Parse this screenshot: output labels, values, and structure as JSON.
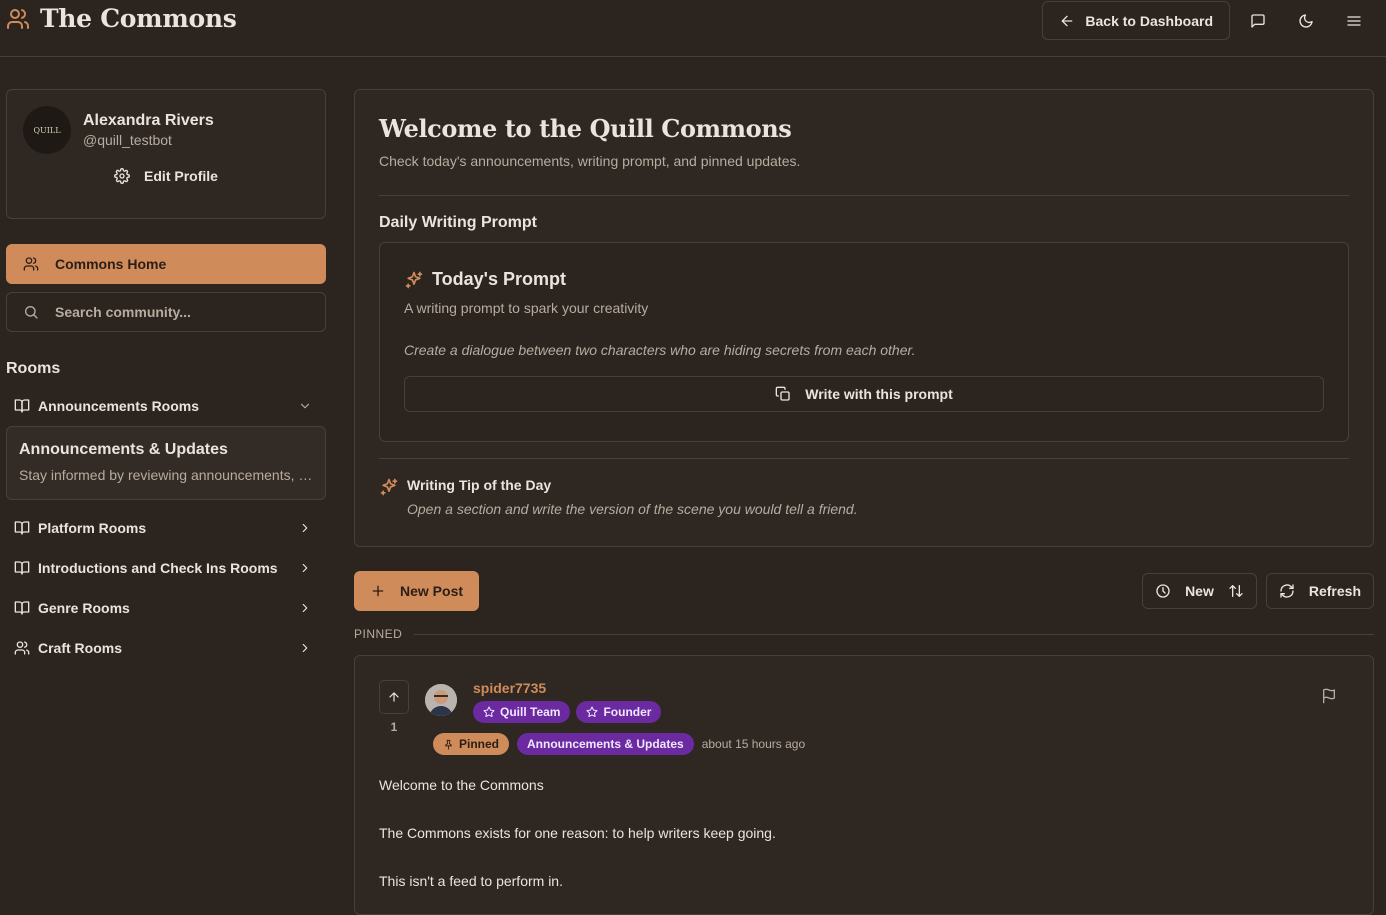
{
  "header": {
    "brand": "The Commons",
    "back_label": "Back to Dashboard"
  },
  "profile": {
    "name": "Alexandra Rivers",
    "handle": "@quill_testbot",
    "avatar_text": "QUILL",
    "edit_label": "Edit Profile"
  },
  "nav": {
    "home_label": "Commons Home",
    "search_placeholder": "Search community..."
  },
  "rooms": {
    "heading": "Rooms",
    "groups": [
      {
        "label": "Announcements Rooms",
        "icon": "book-icon",
        "expanded": true
      },
      {
        "label": "Platform Rooms",
        "icon": "book-icon"
      },
      {
        "label": "Introductions and Check Ins Rooms",
        "icon": "book-icon"
      },
      {
        "label": "Genre Rooms",
        "icon": "book-icon"
      },
      {
        "label": "Craft Rooms",
        "icon": "users-icon"
      }
    ],
    "active_room": {
      "title": "Announcements & Updates",
      "description": "Stay informed by reviewing announcements, platform updates, and news."
    }
  },
  "welcome": {
    "title": "Welcome to the Quill Commons",
    "subtitle": "Check today's announcements, writing prompt, and pinned updates.",
    "prompt_section": "Daily Writing Prompt",
    "prompt_title": "Today's Prompt",
    "prompt_desc": "A writing prompt to spark your creativity",
    "prompt_text": "Create a dialogue between two characters who are hiding secrets from each other.",
    "prompt_button": "Write with this prompt",
    "tip_title": "Writing Tip of the Day",
    "tip_text": "Open a section and write the version of the scene you would tell a friend."
  },
  "toolbar": {
    "new_post": "New Post",
    "sort_label": "New",
    "refresh": "Refresh"
  },
  "pinned_label": "PINNED",
  "post": {
    "author": "spider7735",
    "votes": "1",
    "badges": [
      "Quill Team",
      "Founder"
    ],
    "pinned_badge": "Pinned",
    "room_badge": "Announcements & Updates",
    "time": "about 15 hours ago",
    "body": [
      "Welcome to the Commons",
      "The Commons exists for one reason: to help writers keep going.",
      "This isn't a feed to perform in."
    ]
  },
  "colors": {
    "accent": "#d08b5b",
    "badge_purple": "#6b2aa0",
    "background": "#2b241f",
    "border": "#4a3f37"
  }
}
